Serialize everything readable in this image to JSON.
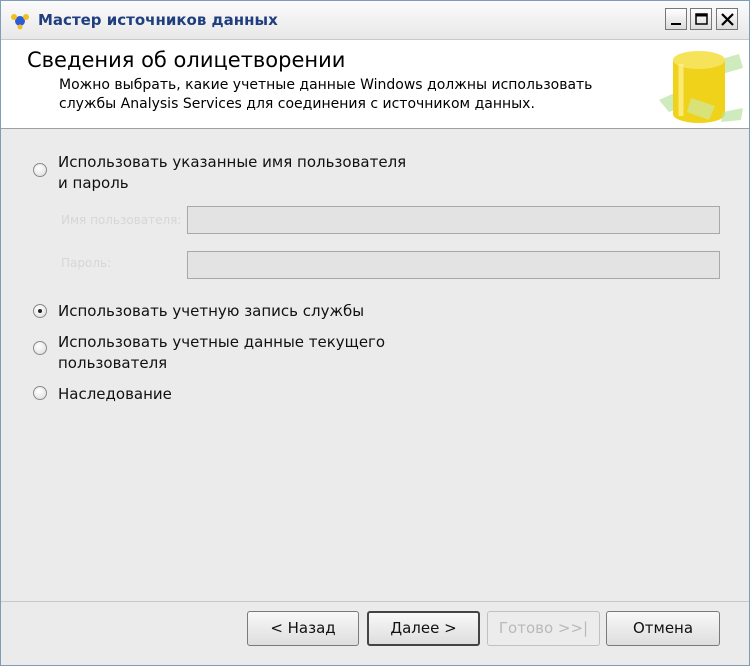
{
  "window": {
    "title": "Мастер источников данных"
  },
  "header": {
    "title": "Сведения об олицетворении",
    "description": "Можно выбрать, какие учетные данные Windows должны использовать службы Analysis Services для соединения с источником данных."
  },
  "options": [
    {
      "label": "Использовать указанные имя пользователя и пароль",
      "checked": false
    },
    {
      "label": "Использовать учетную запись службы",
      "checked": true
    },
    {
      "label": "Использовать учетные данные текущего пользователя",
      "checked": false
    },
    {
      "label": "Наследование",
      "checked": false
    }
  ],
  "credentials": {
    "username_label": "Имя пользователя:",
    "password_label": "Пароль:",
    "username_value": "",
    "password_value": ""
  },
  "buttons": {
    "back": "< Назад",
    "next": "Далее >",
    "finish": "Готово >>|",
    "cancel": "Отмена"
  },
  "colors": {
    "header_bg": "#ffffff",
    "body_bg": "#ebebeb",
    "title_text": "#1f3f7f",
    "cylinder": "#f2d81a"
  }
}
